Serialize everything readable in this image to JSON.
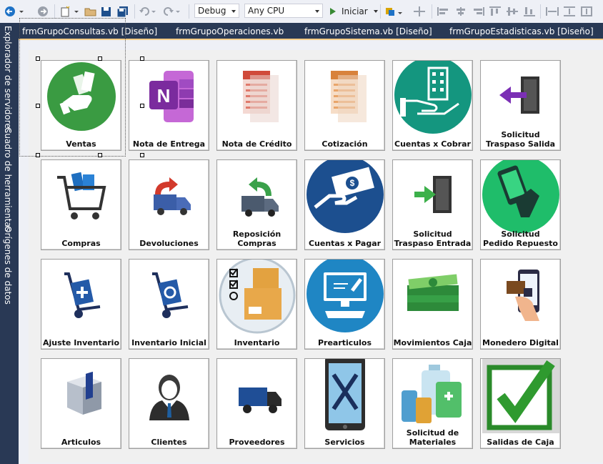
{
  "toolbar": {
    "config": "Debug",
    "platform": "Any CPU",
    "run_label": "Iniciar"
  },
  "side_tabs": [
    "Explorador de servidores",
    "Cuadro de herramientas",
    "Orígenes de datos"
  ],
  "doc_tabs": [
    "frmGrupoConsultas.vb [Diseño]",
    "frmGrupoOperaciones.vb",
    "frmGrupoSistema.vb [Diseño]",
    "frmGrupoEstadisticas.vb [Diseño]"
  ],
  "tiles": [
    {
      "label": "Ventas",
      "icon": "money-hand-icon"
    },
    {
      "label": "Nota de Entrega",
      "icon": "onenote-icon"
    },
    {
      "label": "Nota de Crédito",
      "icon": "credit-document-icon"
    },
    {
      "label": "Cotización",
      "icon": "quote-document-icon"
    },
    {
      "label": "Cuentas x Cobrar",
      "icon": "building-hand-icon"
    },
    {
      "label": "Solicitud\nTraspaso Salida",
      "icon": "door-exit-icon"
    },
    {
      "label": "Compras",
      "icon": "shopping-cart-icon"
    },
    {
      "label": "Devoluciones",
      "icon": "return-truck-icon"
    },
    {
      "label": "Reposición\nCompras",
      "icon": "restock-truck-icon"
    },
    {
      "label": "Cuentas x Pagar",
      "icon": "bill-payment-icon"
    },
    {
      "label": "Solicitud\nTraspaso Entrada",
      "icon": "door-enter-icon"
    },
    {
      "label": "Solicitud\nPedido Repuesto",
      "icon": "phone-hand-icon"
    },
    {
      "label": "Ajuste Inventario",
      "icon": "hand-truck-plus-icon"
    },
    {
      "label": "Inventario Inicial",
      "icon": "hand-truck-refresh-icon"
    },
    {
      "label": "Inventario",
      "icon": "inventory-boxes-icon"
    },
    {
      "label": "Prearticulos",
      "icon": "monitor-edit-icon"
    },
    {
      "label": "Movimientos Caja",
      "icon": "cash-stack-icon"
    },
    {
      "label": "Monedero Digital",
      "icon": "mobile-wallet-icon"
    },
    {
      "label": "Articulos",
      "icon": "product-box-icon"
    },
    {
      "label": "Clientes",
      "icon": "customer-person-icon"
    },
    {
      "label": "Proveedores",
      "icon": "delivery-truck-icon"
    },
    {
      "label": "Servicios",
      "icon": "phone-tools-icon"
    },
    {
      "label": "Solicitud de\nMateriales",
      "icon": "cleaning-supplies-icon"
    },
    {
      "label": "Salidas de Caja",
      "icon": "checkmark-icon"
    }
  ],
  "colors": {
    "panel_dark": "#293955",
    "tab_accent": "#f5cc84",
    "designer_bg": "#eef0f6"
  }
}
